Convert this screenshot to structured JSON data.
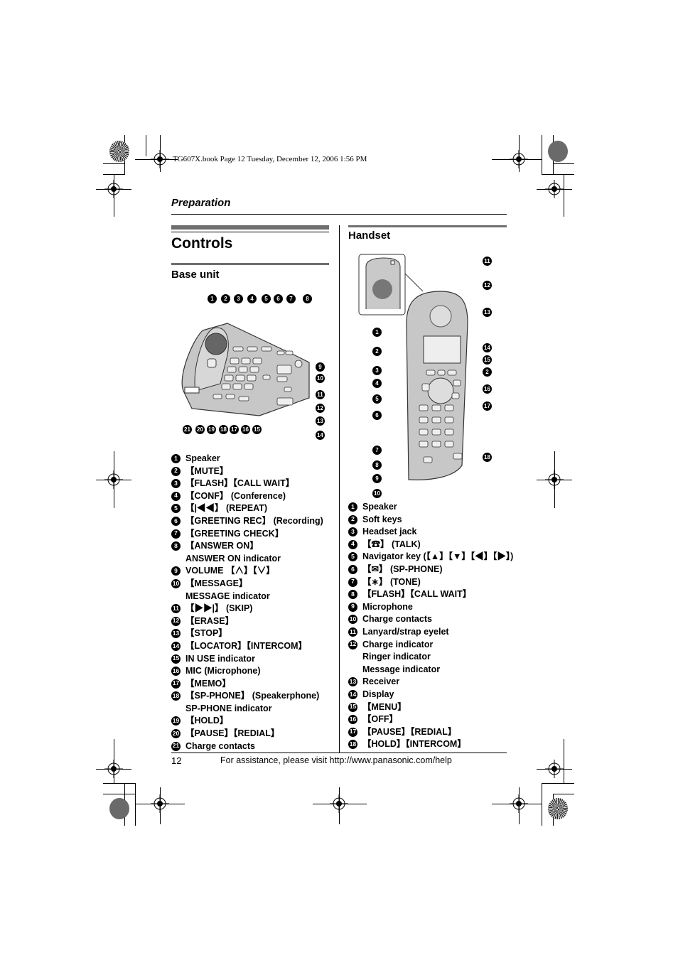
{
  "header": {
    "book_line": "TG607X.book  Page 12  Tuesday, December 12, 2006  1:56 PM",
    "section": "Preparation"
  },
  "left": {
    "title": "Controls",
    "subtitle": "Base unit",
    "callouts_top": [
      "1",
      "2",
      "3",
      "4",
      "5",
      "6",
      "7",
      "8"
    ],
    "callouts_right": [
      "9",
      "10",
      "11",
      "12",
      "13",
      "14"
    ],
    "callouts_bottom": [
      "21",
      "20",
      "19",
      "18",
      "17",
      "16",
      "15"
    ],
    "items": [
      {
        "n": "1",
        "lines": [
          "Speaker"
        ]
      },
      {
        "n": "2",
        "lines": [
          "【MUTE】"
        ]
      },
      {
        "n": "3",
        "lines": [
          "【FLASH】【CALL WAIT】"
        ]
      },
      {
        "n": "4",
        "lines": [
          "【CONF】 (Conference)"
        ]
      },
      {
        "n": "5",
        "lines": [
          "【|◀◀】 (REPEAT)"
        ]
      },
      {
        "n": "6",
        "lines": [
          "【GREETING REC】 (Recording)"
        ]
      },
      {
        "n": "7",
        "lines": [
          "【GREETING CHECK】"
        ]
      },
      {
        "n": "8",
        "lines": [
          "【ANSWER ON】",
          "ANSWER ON indicator"
        ]
      },
      {
        "n": "9",
        "lines": [
          "VOLUME 【∧】【∨】"
        ]
      },
      {
        "n": "10",
        "lines": [
          "【MESSAGE】",
          "MESSAGE indicator"
        ]
      },
      {
        "n": "11",
        "lines": [
          "【▶▶|】 (SKIP)"
        ]
      },
      {
        "n": "12",
        "lines": [
          "【ERASE】"
        ]
      },
      {
        "n": "13",
        "lines": [
          "【STOP】"
        ]
      },
      {
        "n": "14",
        "lines": [
          "【LOCATOR】【INTERCOM】"
        ]
      },
      {
        "n": "15",
        "lines": [
          "IN USE indicator"
        ]
      },
      {
        "n": "16",
        "lines": [
          "MIC (Microphone)"
        ]
      },
      {
        "n": "17",
        "lines": [
          "【MEMO】"
        ]
      },
      {
        "n": "18",
        "lines": [
          "【SP-PHONE】 (Speakerphone)",
          "SP-PHONE indicator"
        ]
      },
      {
        "n": "19",
        "lines": [
          "【HOLD】"
        ]
      },
      {
        "n": "20",
        "lines": [
          "【PAUSE】【REDIAL】"
        ]
      },
      {
        "n": "21",
        "lines": [
          "Charge contacts"
        ]
      }
    ]
  },
  "right": {
    "subtitle": "Handset",
    "callouts_right": [
      "11",
      "12",
      "13",
      "14",
      "15",
      "2",
      "16",
      "17",
      "18"
    ],
    "callouts_left": [
      "1",
      "2",
      "3",
      "4",
      "5",
      "6",
      "7",
      "8",
      "9",
      "10"
    ],
    "items": [
      {
        "n": "1",
        "lines": [
          "Speaker"
        ]
      },
      {
        "n": "2",
        "lines": [
          "Soft keys"
        ]
      },
      {
        "n": "3",
        "lines": [
          "Headset jack"
        ]
      },
      {
        "n": "4",
        "lines": [
          "【☎】 (TALK)"
        ]
      },
      {
        "n": "5",
        "lines": [
          "Navigator key (【▲】【▼】【◀】【▶】)"
        ]
      },
      {
        "n": "6",
        "lines": [
          "【✉】 (SP-PHONE)"
        ]
      },
      {
        "n": "7",
        "lines": [
          "【∗】 (TONE)"
        ]
      },
      {
        "n": "8",
        "lines": [
          "【FLASH】【CALL WAIT】"
        ]
      },
      {
        "n": "9",
        "lines": [
          "Microphone"
        ]
      },
      {
        "n": "10",
        "lines": [
          "Charge contacts"
        ]
      },
      {
        "n": "11",
        "lines": [
          "Lanyard/strap eyelet"
        ]
      },
      {
        "n": "12",
        "lines": [
          "Charge indicator",
          "Ringer indicator",
          "Message indicator"
        ]
      },
      {
        "n": "13",
        "lines": [
          "Receiver"
        ]
      },
      {
        "n": "14",
        "lines": [
          "Display"
        ]
      },
      {
        "n": "15",
        "lines": [
          "【MENU】"
        ]
      },
      {
        "n": "16",
        "lines": [
          "【OFF】"
        ]
      },
      {
        "n": "17",
        "lines": [
          "【PAUSE】【REDIAL】"
        ]
      },
      {
        "n": "18",
        "lines": [
          "【HOLD】【INTERCOM】"
        ]
      }
    ]
  },
  "footer": {
    "page_number": "12",
    "assistance": "For assistance, please visit http://www.panasonic.com/help"
  }
}
